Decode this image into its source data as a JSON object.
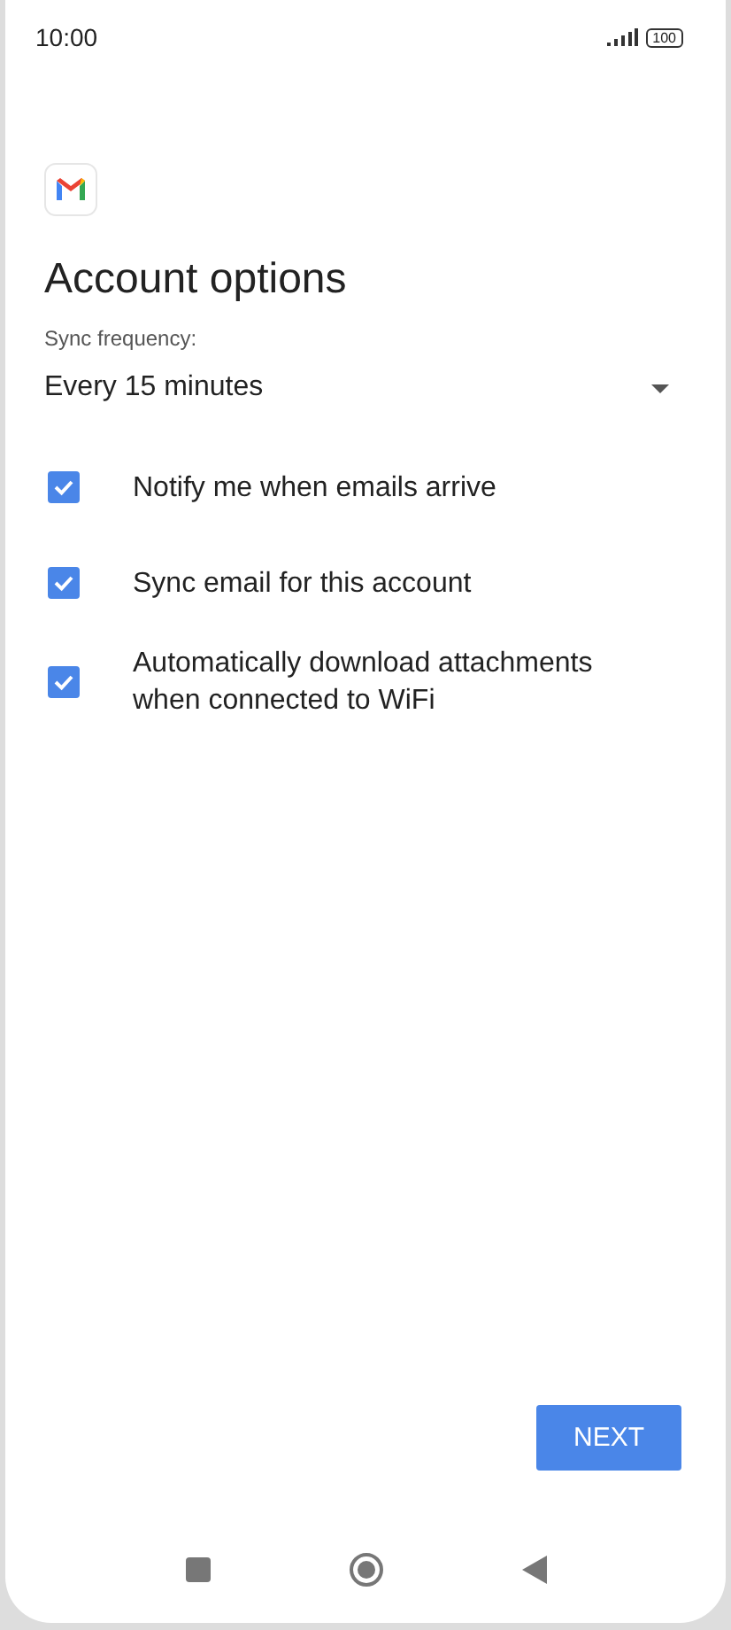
{
  "status_bar": {
    "time": "10:00",
    "battery": "100"
  },
  "title": "Account options",
  "sync_frequency": {
    "label": "Sync frequency:",
    "value": "Every 15 minutes"
  },
  "options": [
    {
      "label": "Notify me when emails arrive",
      "checked": true
    },
    {
      "label": "Sync email for this account",
      "checked": true
    },
    {
      "label": "Automatically download attachments when connected to WiFi",
      "checked": true
    }
  ],
  "next_button": "NEXT"
}
